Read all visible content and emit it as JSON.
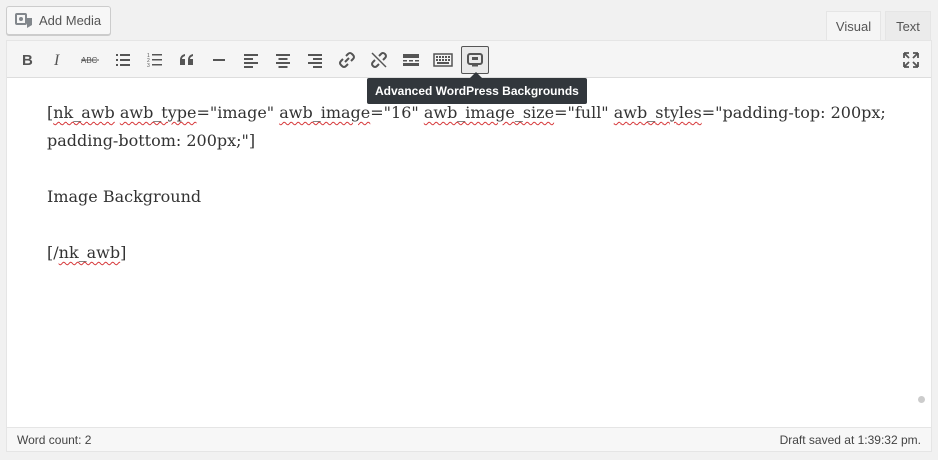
{
  "add_media": {
    "label": "Add Media",
    "icon": "media-icon"
  },
  "tabs": [
    {
      "label": "Visual",
      "active": true
    },
    {
      "label": "Text",
      "active": false
    }
  ],
  "toolbar": {
    "buttons": [
      {
        "name": "bold",
        "icon": "bold-icon"
      },
      {
        "name": "italic",
        "icon": "italic-icon"
      },
      {
        "name": "strikethrough",
        "icon": "strikethrough-icon",
        "glyph": "ABC"
      },
      {
        "name": "bulleted-list",
        "icon": "bulleted-list-icon"
      },
      {
        "name": "numbered-list",
        "icon": "numbered-list-icon"
      },
      {
        "name": "blockquote",
        "icon": "blockquote-icon"
      },
      {
        "name": "horizontal-line",
        "icon": "horizontal-line-icon"
      },
      {
        "name": "align-left",
        "icon": "align-left-icon"
      },
      {
        "name": "align-center",
        "icon": "align-center-icon"
      },
      {
        "name": "align-right",
        "icon": "align-right-icon"
      },
      {
        "name": "insert-link",
        "icon": "link-icon"
      },
      {
        "name": "remove-link",
        "icon": "unlink-icon"
      },
      {
        "name": "read-more",
        "icon": "read-more-icon"
      },
      {
        "name": "toolbar-toggle",
        "icon": "keyboard-icon"
      },
      {
        "name": "advanced-backgrounds",
        "icon": "awb-icon",
        "active": true
      },
      {
        "name": "fullscreen",
        "icon": "fullscreen-icon"
      }
    ],
    "tooltip": "Advanced WordPress Backgrounds"
  },
  "content": {
    "shortcode_open": {
      "parts": [
        "[",
        "nk_awb",
        " ",
        "awb_type",
        "=\"image\" ",
        "awb_image",
        "=\"16\" ",
        "awb_image_size",
        "=\"full\" ",
        "awb_styles",
        "=\"padding-top: 200px; padding-bottom: 200px;\"]"
      ]
    },
    "body_text": "Image Background",
    "shortcode_close": {
      "parts": [
        "[/",
        "nk_awb",
        "]"
      ]
    }
  },
  "status": {
    "word_count": "Word count: 2",
    "draft_saved": "Draft saved at 1:39:32 pm."
  }
}
